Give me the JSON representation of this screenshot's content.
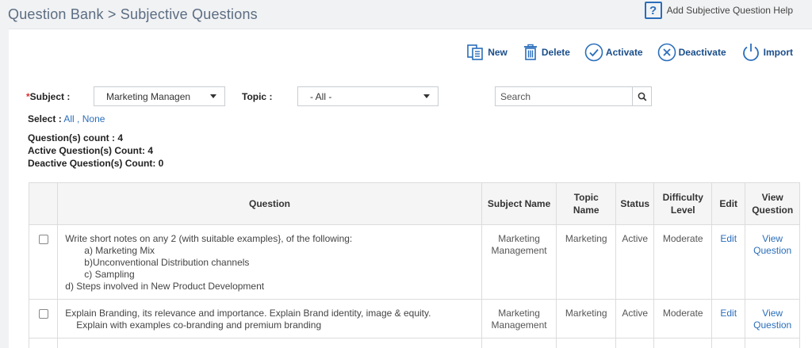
{
  "header": {
    "title": "Question Bank > Subjective Questions",
    "help_label": "Add Subjective Question Help",
    "help_icon": "help-icon"
  },
  "toolbar": {
    "new_label": "New",
    "delete_label": "Delete",
    "activate_label": "Activate",
    "deactivate_label": "Deactivate",
    "import_label": "Import"
  },
  "filters": {
    "subject_label": "Subject :",
    "subject_required_mark": "*",
    "subject_value": "Marketing Managen",
    "topic_label": "Topic :",
    "topic_value": "- All -",
    "search_placeholder": "Search"
  },
  "selection": {
    "label": "Select :",
    "all": "All",
    "separator": ",",
    "none": "None"
  },
  "counts": {
    "questions": "Question(s) count : 4",
    "active": "Active Question(s) Count: 4",
    "deactive": "Deactive Question(s) Count: 0"
  },
  "table": {
    "headers": {
      "question": "Question",
      "subject_name": "Subject Name",
      "topic_name": "Topic Name",
      "status": "Status",
      "difficulty": "Difficulty Level",
      "edit": "Edit",
      "view": "View Question"
    },
    "rows": [
      {
        "question_lines": [
          "Write short notes on any 2 (with suitable examples}, of the following:",
          "a)    Marketing Mix",
          "b)Unconventional Distribution channels",
          "c)    Sampling",
          "d)    Steps involved in New Product Development"
        ],
        "subject_name": "Marketing Management",
        "topic_name": "Marketing",
        "status": "Active",
        "difficulty": "Moderate",
        "edit": "Edit",
        "view": "View Question"
      },
      {
        "question_lines": [
          "Explain Branding, its relevance and importance. Explain Brand identity, image & equity.",
          "Explain with examples co-branding and premium branding"
        ],
        "subject_name": "Marketing Management",
        "topic_name": "Marketing",
        "status": "Active",
        "difficulty": "Moderate",
        "edit": "Edit",
        "view": "View Question"
      }
    ]
  },
  "colors": {
    "link": "#2a6ebb",
    "toolbar_text": "#1a4e8a",
    "required": "#d9302c",
    "title": "#5b6d82"
  }
}
